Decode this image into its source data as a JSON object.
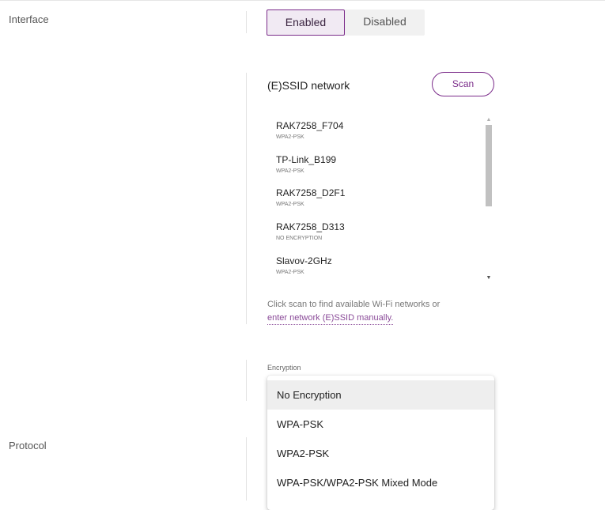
{
  "rows": {
    "interface_label": "Interface",
    "protocol_label": "Protocol"
  },
  "toggle": {
    "enabled_label": "Enabled",
    "disabled_label": "Disabled",
    "active": "Enabled"
  },
  "essid": {
    "title": "(E)SSID network",
    "scan_label": "Scan",
    "networks": [
      {
        "name": "RAK7258_F704",
        "encryption": "WPA2-PSK"
      },
      {
        "name": "TP-Link_B199",
        "encryption": "WPA2-PSK"
      },
      {
        "name": "RAK7258_D2F1",
        "encryption": "WPA2-PSK"
      },
      {
        "name": "RAK7258_D313",
        "encryption": "NO ENCRYPTION"
      },
      {
        "name": "Slavov-2GHz",
        "encryption": "WPA2-PSK"
      }
    ],
    "hint_text": "Click scan to find available Wi-Fi networks or",
    "manual_link": "enter network (E)SSID manually."
  },
  "encryption": {
    "label": "Encryption",
    "options": [
      "No Encryption",
      "WPA-PSK",
      "WPA2-PSK",
      "WPA-PSK/WPA2-PSK Mixed Mode"
    ],
    "highlighted": "No Encryption"
  },
  "colors": {
    "accent": "#7b2c8a",
    "link": "#8a4a98"
  },
  "icons": {
    "scroll_up": "triangle-up",
    "scroll_down": "triangle-down"
  }
}
